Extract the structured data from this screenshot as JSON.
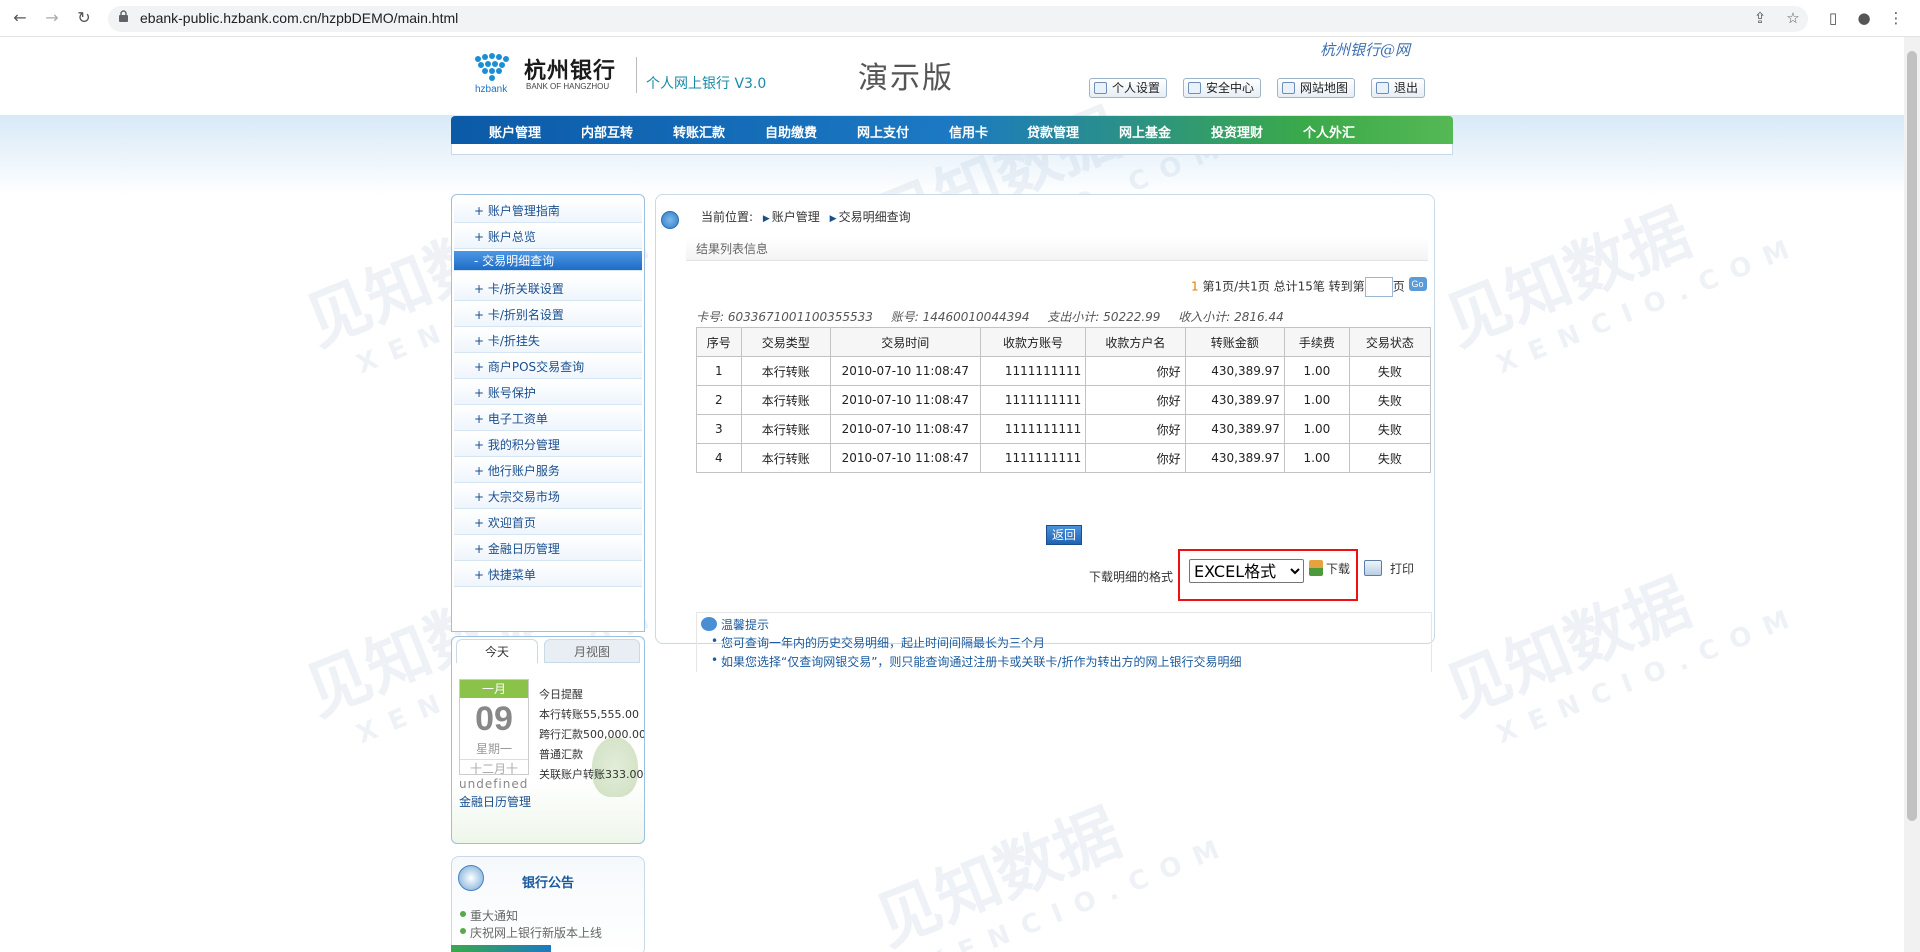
{
  "browser": {
    "url": "ebank-public.hzbank.com.cn/hzpbDEMO/main.html",
    "icons": [
      "back-icon",
      "forward-icon",
      "reload-icon",
      "lock-icon",
      "share-icon",
      "star-icon",
      "sidepanel-icon",
      "profile-icon",
      "menu-icon"
    ]
  },
  "header": {
    "bank_name": "杭州银行",
    "bank_name_en": "BANK OF HANGZHOU",
    "logo_text": "hzbank",
    "product": "个人网上银行 V3.0",
    "demo_label": "演示版",
    "slogan": "杭州银行@网",
    "links": [
      "个人设置",
      "安全中心",
      "网站地图",
      "退出"
    ]
  },
  "nav": {
    "items": [
      "账户管理",
      "内部互转",
      "转账汇款",
      "自助缴费",
      "网上支付",
      "信用卡",
      "贷款管理",
      "网上基金",
      "投资理财",
      "个人外汇"
    ]
  },
  "sidebar": {
    "items": [
      "+ 账户管理指南",
      "+ 账户总览",
      "- 交易明细查询",
      "+ 卡/折关联设置",
      "+ 卡/折别名设置",
      "+ 卡/折挂失",
      "+ 商户POS交易查询",
      "+ 账号保护",
      "+ 电子工资单",
      "+ 我的积分管理",
      "+ 他行账户服务",
      "+ 大宗交易市场",
      "+ 欢迎首页",
      "+ 金融日历管理",
      "+ 快捷菜单"
    ],
    "active_index": 2
  },
  "calendar": {
    "tabs": [
      "今天",
      "月视图"
    ],
    "month": "一月",
    "day": "09",
    "weekday": "星期一",
    "lunar": "十二月十",
    "undefined_text": "undefined",
    "link": "金融日历管理",
    "reminders": [
      "今日提醒",
      "本行转账55,555.00",
      "跨行汇款500,000.00",
      "普通汇款",
      "关联账户转账333.00"
    ]
  },
  "notice": {
    "title": "银行公告",
    "items": [
      "重大通知",
      "庆祝网上银行新版本上线"
    ]
  },
  "content": {
    "breadcrumb_label": "当前位置:",
    "breadcrumb": [
      "账户管理",
      "交易明细查询"
    ],
    "section_title": "结果列表信息",
    "pager": {
      "current": "1",
      "text": "第1页/共1页 总计15笔 转到第",
      "suffix": "页",
      "go": "Go"
    },
    "summary": {
      "card": "卡号: 6033671001100355533",
      "account": "账号: 14460010044394",
      "expense": "支出小计: 50222.99",
      "income": "收入小计: 2816.44"
    },
    "table": {
      "headers": [
        "序号",
        "交易类型",
        "交易时间",
        "收款方账号",
        "收款方户名",
        "转账金额",
        "手续费",
        "交易状态"
      ],
      "rows": [
        [
          "1",
          "本行转账",
          "2010-07-10 11:08:47",
          "1111111111",
          "你好",
          "430,389.97",
          "1.00",
          "失败"
        ],
        [
          "2",
          "本行转账",
          "2010-07-10 11:08:47",
          "1111111111",
          "你好",
          "430,389.97",
          "1.00",
          "失败"
        ],
        [
          "3",
          "本行转账",
          "2010-07-10 11:08:47",
          "1111111111",
          "你好",
          "430,389.97",
          "1.00",
          "失败"
        ],
        [
          "4",
          "本行转账",
          "2010-07-10 11:08:47",
          "1111111111",
          "你好",
          "430,389.97",
          "1.00",
          "失败"
        ]
      ]
    },
    "back_button": "返回",
    "download_label": "下载明细的格式",
    "format_selected": "EXCEL格式",
    "download_button": "下载",
    "print_button": "打印",
    "tips_title": "温馨提示",
    "tips": [
      "您可查询一年内的历史交易明细，起止时间间隔最长为三个月",
      "如果您选择“仅查询网银交易”，则只能查询通过注册卡或关联卡/折作为转出方的网上银行交易明细"
    ]
  },
  "watermark": {
    "cn": "见知数据",
    "en": "XENCIO.COM"
  }
}
